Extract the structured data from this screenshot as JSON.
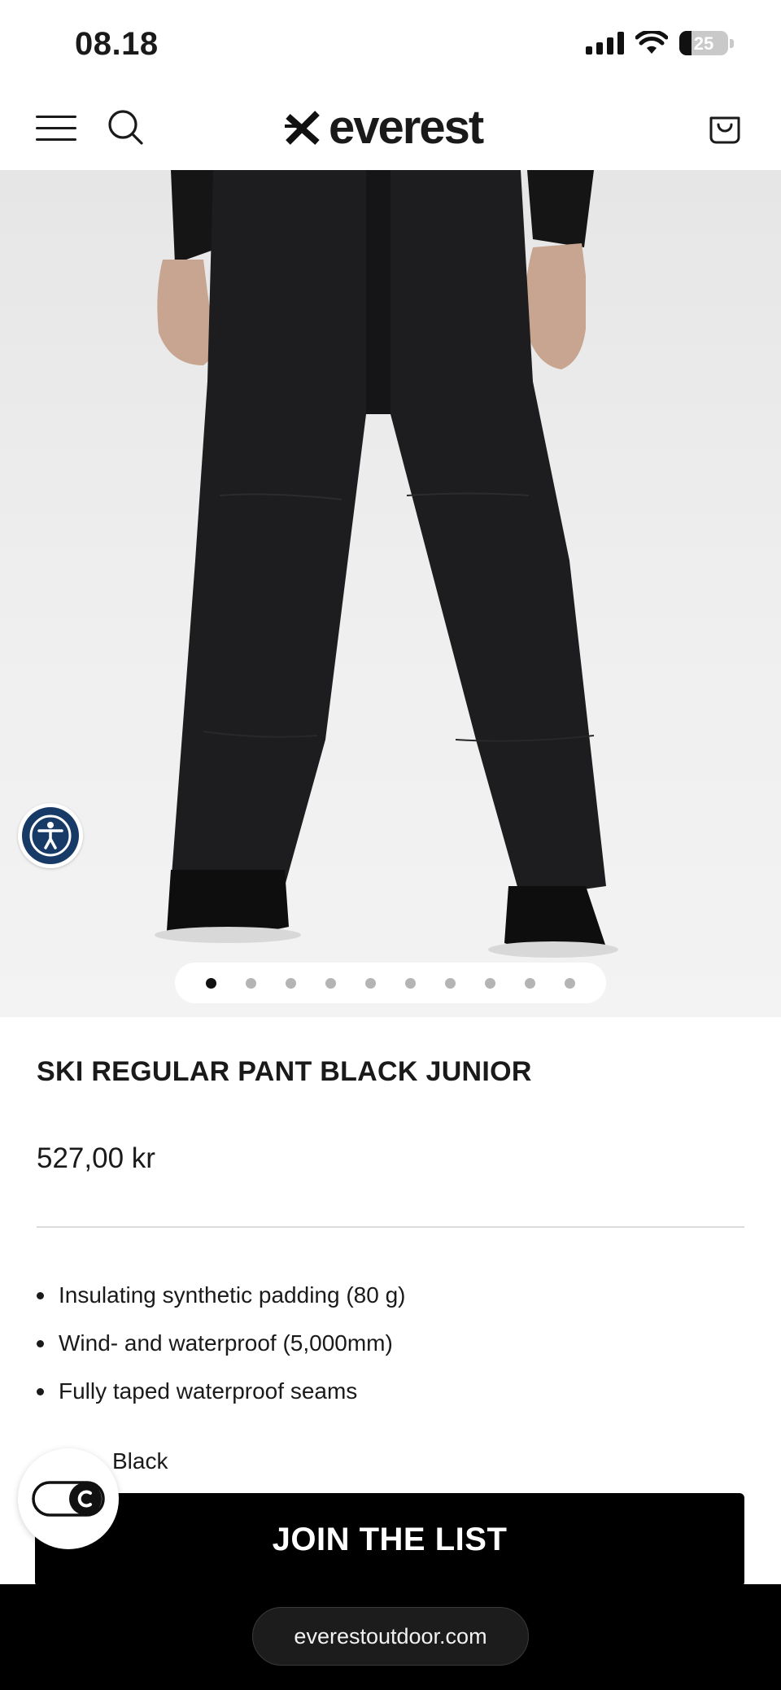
{
  "status_bar": {
    "time": "08.18",
    "battery_level": "25",
    "icons": [
      "signal-icon",
      "wifi-icon",
      "battery-icon"
    ]
  },
  "header": {
    "logo_text": "everest",
    "icons": [
      "menu-icon",
      "search-icon",
      "logo-x-icon",
      "cart-icon"
    ]
  },
  "gallery": {
    "image_count": 10,
    "active_index": 0,
    "image_subject": "black ski pants",
    "icons": [
      "accessibility-icon"
    ]
  },
  "product": {
    "title": "SKI REGULAR PANT BLACK JUNIOR",
    "price": "527,00 kr",
    "features": [
      "Insulating synthetic padding (80 g)",
      "Wind- and waterproof (5,000mm)",
      "Fully taped waterproof seams"
    ],
    "color": "Black"
  },
  "cta": {
    "join_label": "JOIN THE LIST"
  },
  "cookie_widget": {
    "icon": "cookie-consent-icon"
  },
  "browser": {
    "url": "everestoutdoor.com"
  },
  "colors": {
    "brand_black": "#000000",
    "accessibility_blue": "#173a66",
    "text": "#1a1a1a"
  }
}
